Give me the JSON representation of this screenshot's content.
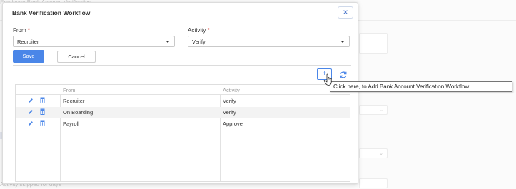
{
  "background": {
    "top_text": "Employee Bank Account Verification",
    "bottom_text": "Activity skipped for days"
  },
  "modal": {
    "title": "Bank Verification Workflow",
    "close_icon": "close-icon"
  },
  "form": {
    "from_label": "From",
    "from_value": "Recruiter",
    "activity_label": "Activity",
    "activity_value": "Verify",
    "required_mark": "*"
  },
  "buttons": {
    "save_label": "Save",
    "cancel_label": "Cancel",
    "add_label": "+"
  },
  "table": {
    "columns": [
      "From",
      "Activity"
    ],
    "rows": [
      {
        "from": "Recruiter",
        "activity": "Verify"
      },
      {
        "from": "On Boarding",
        "activity": "Verify"
      },
      {
        "from": "Payroll",
        "activity": "Approve"
      }
    ]
  },
  "tooltip": {
    "text": "Click here, to Add Bank Account Verification Workflow"
  },
  "colors": {
    "accent": "#4a86e8",
    "required": "#d9342b"
  }
}
